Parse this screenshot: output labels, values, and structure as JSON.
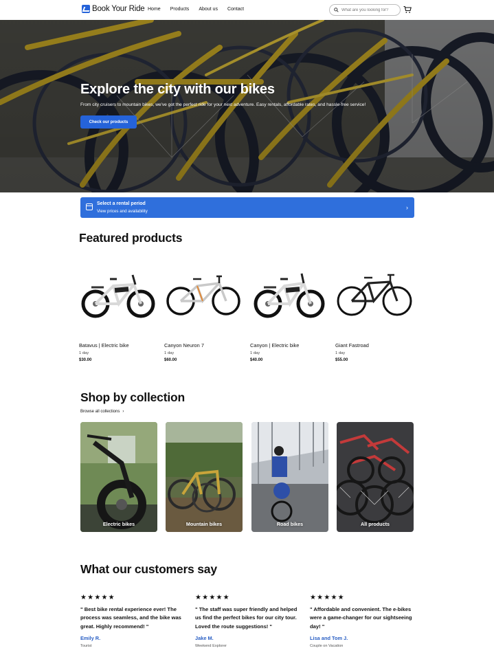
{
  "header": {
    "logo_text": "Book Your Ride",
    "nav": [
      "Home",
      "Products",
      "About us",
      "Contact"
    ],
    "search_placeholder": "What are you looking for?"
  },
  "hero": {
    "title": "Explore the city with our bikes",
    "subtitle": "From city cruisers to mountain bikes, we've got the perfect ride for your next adventure. Easy rentals, affordable rates, and hassle-free service!",
    "cta_label": "Check our products"
  },
  "rental_bar": {
    "title": "Select a rental period",
    "subtitle": "View prices and availability"
  },
  "featured": {
    "heading": "Featured products",
    "products": [
      {
        "name": "Batavus | Electric bike",
        "period": "1 day",
        "price": "$30.00",
        "frame_color": "#d9d9d9",
        "type": "electric"
      },
      {
        "name": "Canyon Neuron 7",
        "period": "1 day",
        "price": "$60.00",
        "frame_color": "#c9c9c9",
        "type": "mountain"
      },
      {
        "name": "Canyon | Electric bike",
        "period": "1 day",
        "price": "$40.00",
        "frame_color": "#d9d9d9",
        "type": "electric"
      },
      {
        "name": "Giant Fastroad",
        "period": "1 day",
        "price": "$55.00",
        "frame_color": "#222222",
        "type": "road"
      }
    ]
  },
  "collections": {
    "heading": "Shop by collection",
    "browse_label": "Browse all collections",
    "items": [
      {
        "label": "Electric bikes"
      },
      {
        "label": "Mountain bikes"
      },
      {
        "label": "Road bikes"
      },
      {
        "label": "All products"
      }
    ]
  },
  "testimonials": {
    "heading": "What our customers say",
    "stars": "★★★★★",
    "items": [
      {
        "quote": "\" Best bike rental experience ever! The process was seamless, and the bike was great. Highly recommend! \"",
        "author": "Emily R.",
        "role": "Tourist"
      },
      {
        "quote": "\" The staff was super friendly and helped us find the perfect bikes for our city tour. Loved the route suggestions! \"",
        "author": "Jake M.",
        "role": "Weekend Explorer"
      },
      {
        "quote": "\" Affordable and convenient. The e-bikes were a game-changer for our sightseeing day! \"",
        "author": "Lisa and Tom J.",
        "role": "Couple on Vacation"
      }
    ]
  },
  "colors": {
    "accent": "#2563d9",
    "rental_bar": "#2f6fdc",
    "author": "#2a5fc4"
  }
}
